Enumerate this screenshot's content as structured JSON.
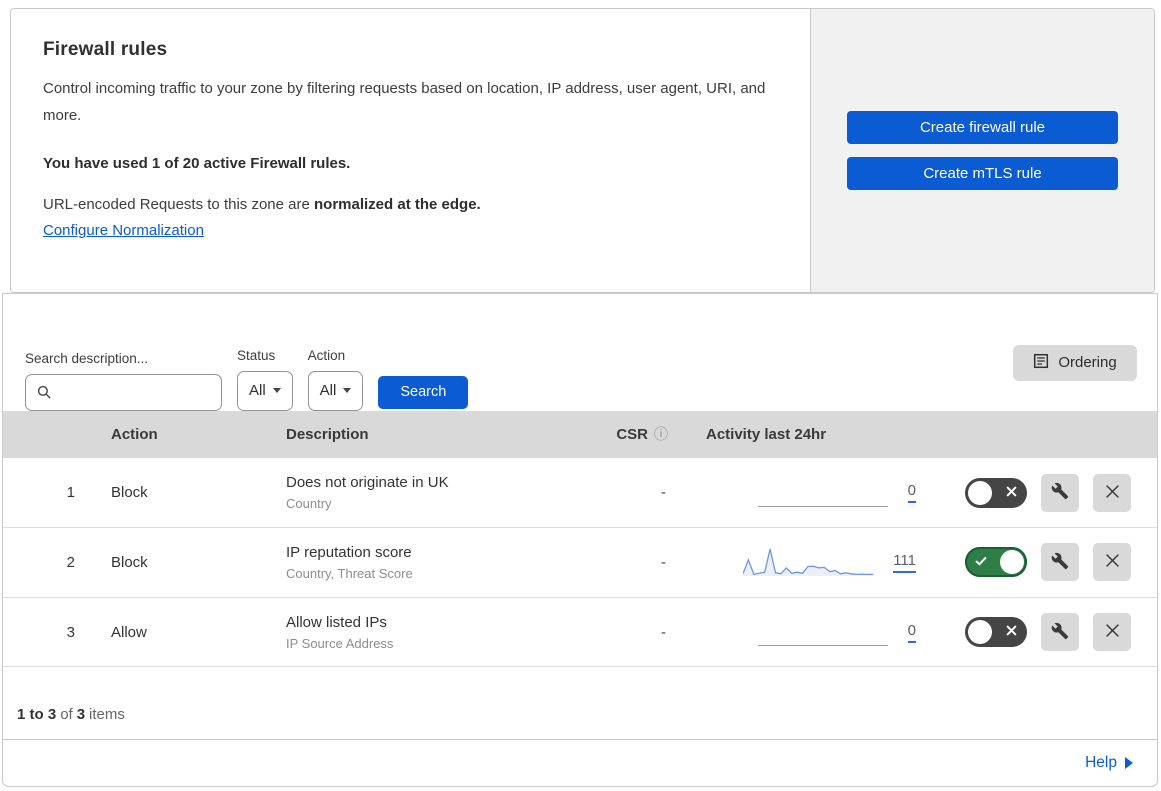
{
  "colors": {
    "accent_blue": "#0b5bd3",
    "link_blue": "#0b5bd3",
    "toggle_on": "#2d7f47",
    "toggle_on_ring": "#1e5c33",
    "toggle_off": "#454545",
    "band_grey": "#d9d9d9",
    "btn_grey": "#d9d9d9",
    "panel_grey": "#f1f1f1",
    "border_grey": "#c9c9c9",
    "spark_blue": "#6b96e8"
  },
  "header": {
    "title": "Firewall rules",
    "description": "Control incoming traffic to your zone by filtering requests based on location, IP address, user agent, URI, and more.",
    "usage_bold": "You have used 1 of 20 active Firewall rules.",
    "normalization_prefix": "URL-encoded Requests to this zone are ",
    "normalization_bold": "normalized at the edge.",
    "normalization_link": "Configure Normalization",
    "create_firewall_button": "Create firewall rule",
    "create_mtls_button": "Create mTLS rule"
  },
  "filters": {
    "search_label": "Search description...",
    "search_placeholder": "",
    "status_label": "Status",
    "status_value": "All",
    "action_label": "Action",
    "action_value": "All",
    "search_button": "Search",
    "ordering_button": "Ordering"
  },
  "table": {
    "columns": {
      "action": "Action",
      "description": "Description",
      "csr": "CSR",
      "activity": "Activity last 24hr"
    },
    "rows": [
      {
        "index": "1",
        "action": "Block",
        "description": "Does not originate in UK",
        "fields": "Country",
        "csr": "-",
        "activity_count": "0",
        "enabled": false,
        "sparkline": null
      },
      {
        "index": "2",
        "action": "Block",
        "description": "IP reputation score",
        "fields": "Country, Threat Score",
        "csr": "-",
        "activity_count": "111",
        "enabled": true,
        "sparkline": [
          8,
          60,
          6,
          10,
          14,
          100,
          12,
          8,
          30,
          10,
          14,
          10,
          35,
          36,
          30,
          32,
          16,
          20,
          8,
          12,
          8,
          6,
          7,
          6,
          6
        ]
      },
      {
        "index": "3",
        "action": "Allow",
        "description": "Allow listed IPs",
        "fields": "IP Source Address",
        "csr": "-",
        "activity_count": "0",
        "enabled": false,
        "sparkline": null
      }
    ],
    "footer": {
      "range": "1 to 3",
      "of": "of",
      "total": "3",
      "items": "items"
    }
  },
  "help": {
    "label": "Help"
  }
}
